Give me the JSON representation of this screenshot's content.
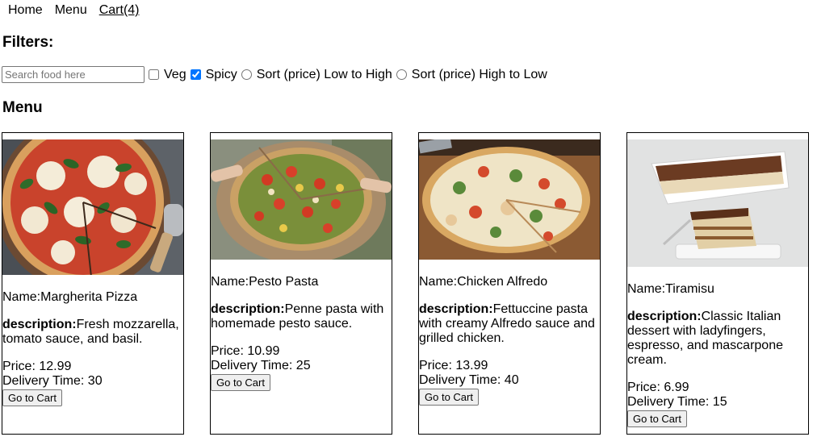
{
  "nav": {
    "home": "Home",
    "menu": "Menu",
    "cart": "Cart(4)"
  },
  "filters": {
    "heading": "Filters:",
    "search_placeholder": "Search food here",
    "veg_label": "Veg",
    "veg_checked": false,
    "spicy_label": "Spicy",
    "spicy_checked": true,
    "sort_low_label": "Sort (price) Low to High",
    "sort_high_label": "Sort (price) High to Low"
  },
  "menu_heading": "Menu",
  "items": [
    {
      "name": "Name:Margherita Pizza",
      "desc_label": "description:",
      "desc": "Fresh mozzarella, tomato sauce, and basil.",
      "price": "Price: 12.99",
      "delivery": "Delivery Time: 30",
      "button": "Go to Cart",
      "image": "margherita-pizza-photo"
    },
    {
      "name": "Name:Pesto Pasta",
      "desc_label": "description:",
      "desc": "Penne pasta with homemade pesto sauce.",
      "price": "Price: 10.99",
      "delivery": "Delivery Time: 25",
      "button": "Go to Cart",
      "image": "pesto-pizza-photo"
    },
    {
      "name": "Name:Chicken Alfredo",
      "desc_label": "description:",
      "desc": "Fettuccine pasta with creamy Alfredo sauce and grilled chicken.",
      "price": "Price: 13.99",
      "delivery": "Delivery Time: 40",
      "button": "Go to Cart",
      "image": "chicken-pizza-photo"
    },
    {
      "name": "Name:Tiramisu",
      "desc_label": "description:",
      "desc": "Classic Italian dessert with ladyfingers, espresso, and mascarpone cream.",
      "price": "Price: 6.99",
      "delivery": "Delivery Time: 15",
      "button": "Go to Cart",
      "image": "tiramisu-photo"
    }
  ]
}
